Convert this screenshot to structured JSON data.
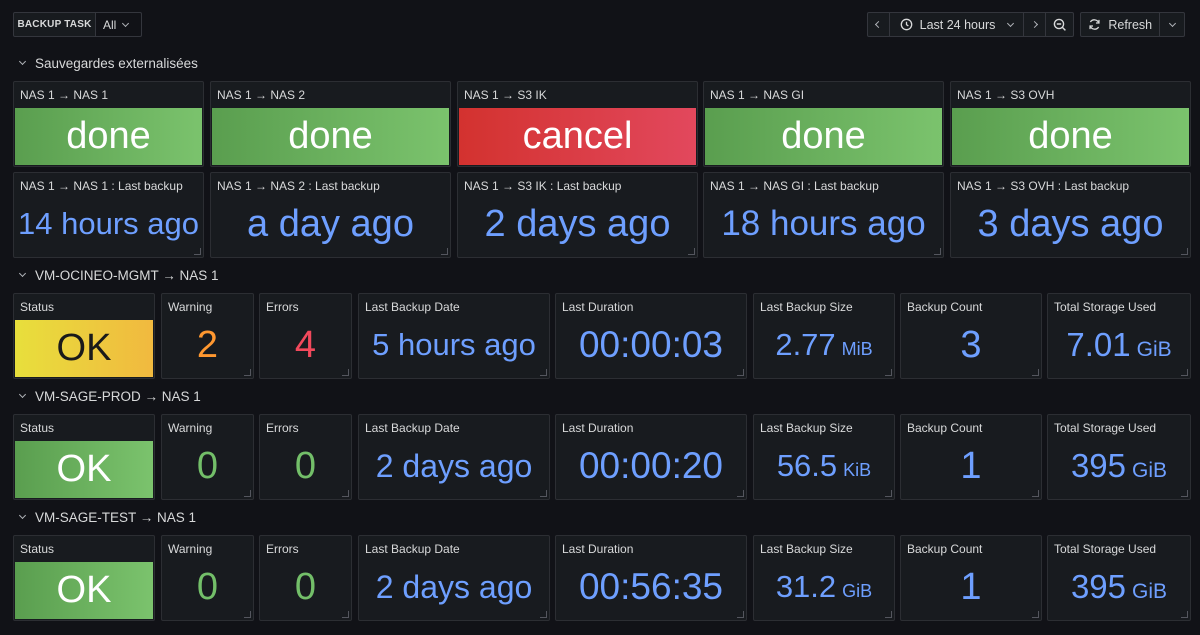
{
  "toolbar": {
    "variable_label": "BACKUP TASK",
    "variable_value": "All",
    "time_range": "Last 24 hours",
    "refresh_label": "Refresh"
  },
  "sections": {
    "external": "Sauvegardes externalisées",
    "mgmt": "VM-OCINEO-MGMT → NAS 1",
    "prod": "VM-SAGE-PROD → NAS 1",
    "test": "VM-SAGE-TEST → NAS 1"
  },
  "status_panels": [
    {
      "title": "NAS 1 → NAS 1",
      "value": "done"
    },
    {
      "title": "NAS 1 → NAS 2",
      "value": "done"
    },
    {
      "title": "NAS 1 → S3 IK",
      "value": "cancel"
    },
    {
      "title": "NAS 1 → NAS GI",
      "value": "done"
    },
    {
      "title": "NAS 1 → S3 OVH",
      "value": "done"
    }
  ],
  "last_backup_panels": [
    {
      "title": "NAS 1 → NAS 1 : Last backup",
      "value": "14 hours ago"
    },
    {
      "title": "NAS 1 → NAS 2 : Last backup",
      "value": "a day ago"
    },
    {
      "title": "NAS 1 → S3 IK : Last backup",
      "value": "2 days ago"
    },
    {
      "title": "NAS 1 → NAS GI : Last backup",
      "value": "18 hours ago"
    },
    {
      "title": "NAS 1 → S3 OVH : Last backup",
      "value": "3 days ago"
    }
  ],
  "labels": {
    "status": "Status",
    "warning": "Warning",
    "errors": "Errors",
    "last_backup_date": "Last Backup Date",
    "last_duration": "Last Duration",
    "last_backup_size": "Last Backup Size",
    "backup_count": "Backup Count",
    "total_storage": "Total Storage Used"
  },
  "vm_rows": [
    {
      "status": "OK",
      "warning": "2",
      "errors": "4",
      "last_date": "5 hours ago",
      "duration": "00:00:03",
      "size": "2.77",
      "size_unit": "MiB",
      "count": "3",
      "storage": "7.01",
      "storage_unit": "GiB"
    },
    {
      "status": "OK",
      "warning": "0",
      "errors": "0",
      "last_date": "2 days ago",
      "duration": "00:00:20",
      "size": "56.5",
      "size_unit": "KiB",
      "count": "1",
      "storage": "395",
      "storage_unit": "GiB"
    },
    {
      "status": "OK",
      "warning": "0",
      "errors": "0",
      "last_date": "2 days ago",
      "duration": "00:56:35",
      "size": "31.2",
      "size_unit": "GiB",
      "count": "1",
      "storage": "395",
      "storage_unit": "GiB"
    }
  ],
  "colors": {
    "done": "#73bf69",
    "cancel": "#e02f44",
    "status_warn": "#fade2a",
    "value_blue": "#6e9fff",
    "value_green": "#73bf69",
    "value_orange": "#ff9830",
    "value_red": "#f2495c"
  }
}
